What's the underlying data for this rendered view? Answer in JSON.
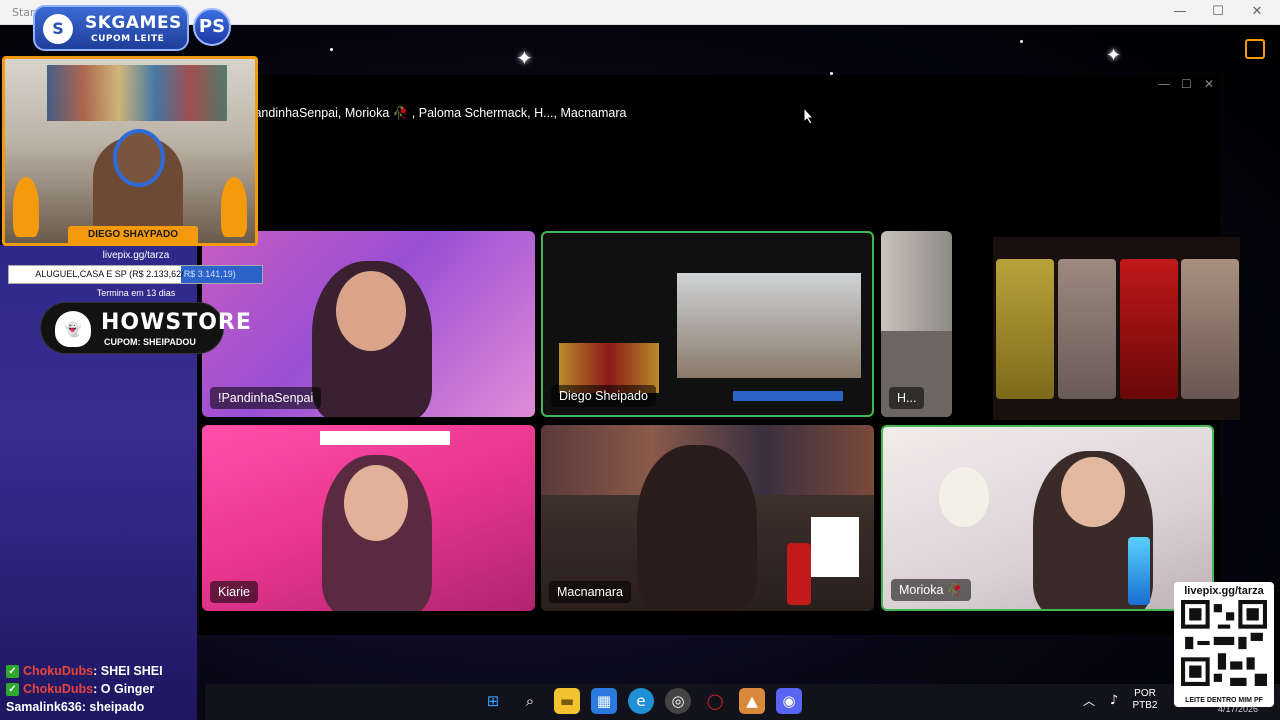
{
  "window": {
    "title": "Stard",
    "minimize": "—",
    "maximize": "☐",
    "close": "✕"
  },
  "brand": {
    "logo": "S",
    "name": "SKGAMES",
    "sub": "CUPOM LEITE",
    "platform_badge": "PS"
  },
  "streamer": {
    "nameplate": "DIEGO SHAYPADO"
  },
  "livepix": {
    "url": "livepix.gg/tarza",
    "goal_text": "ALUGUEL,CASA E SP (R$ 2.133,62/",
    "goal_target": "R$ 3.141,19)",
    "goal_progress_fraction": 0.68,
    "deadline": "Termina em 13 dias"
  },
  "howstore": {
    "icon": "👻",
    "name": "HOWSTORE",
    "coupon": "CUPOM: SHEIPADOU"
  },
  "chat": [
    {
      "user": "ChokuDubs",
      "message": "SHEI SHEI",
      "verified": true,
      "color": "red"
    },
    {
      "user": "ChokuDubs",
      "message": "O Ginger",
      "verified": true,
      "color": "red"
    },
    {
      "user": "Samalink636",
      "message": "sheipado",
      "verified": false,
      "color": "white"
    }
  ],
  "call": {
    "participants_header": "ie, !PandinhaSenpai, Morioka 🥀 , Paloma Schermack, H..., Macnamara",
    "tiles": [
      {
        "label": "!PandinhaSenpai"
      },
      {
        "label": "Diego Sheipado"
      },
      {
        "label": "H..."
      },
      {
        "label": "Kiarie"
      },
      {
        "label": "Macnamara"
      },
      {
        "label": "Morioka 🥀"
      }
    ]
  },
  "qr_card": {
    "title": "livepix.gg/tarza",
    "footer": "LEITE DENTRO MIM PF"
  },
  "taskbar": {
    "icons": [
      "windows-start-icon",
      "search-icon",
      "file-explorer-icon",
      "store-icon",
      "edge-icon",
      "chrome-icon",
      "opera-icon",
      "fox-app-icon",
      "discord-icon"
    ],
    "lang_top": "POR",
    "lang_bottom": "PTB2",
    "date": "4/17/2026"
  },
  "colors": {
    "accent_orange": "#f59a0c",
    "speaking_green": "#3fb950",
    "chat_red": "#e8443a"
  }
}
